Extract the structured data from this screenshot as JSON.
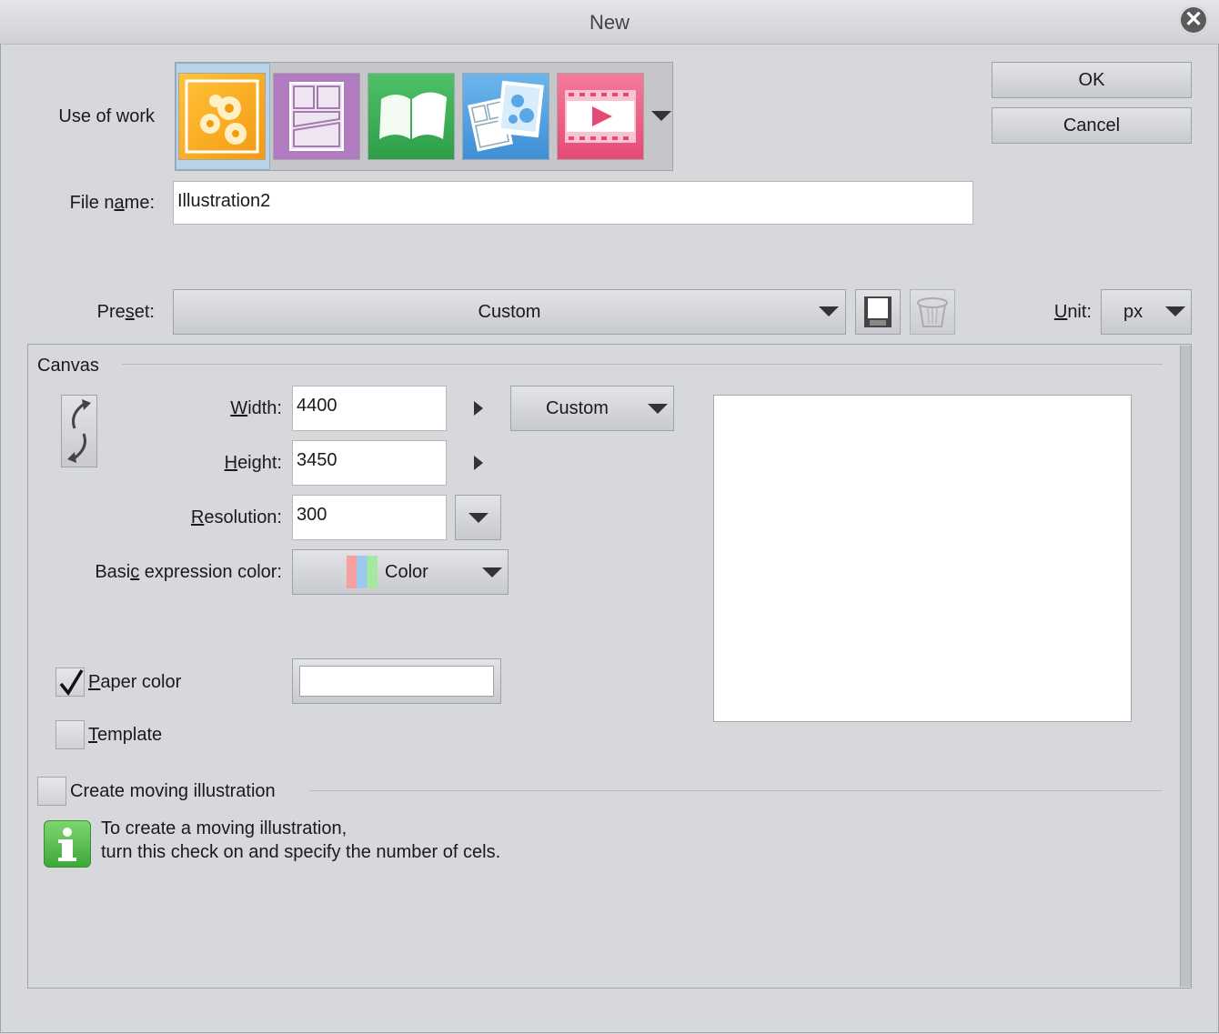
{
  "window": {
    "title": "New"
  },
  "buttons": {
    "ok": "OK",
    "cancel": "Cancel"
  },
  "use_of_work": {
    "label": "Use of work",
    "options": [
      "illustration",
      "comic",
      "book",
      "webtoon",
      "animation"
    ],
    "selected": "illustration"
  },
  "file_name": {
    "label_pre": "File n",
    "label_ul": "a",
    "label_post": "me:",
    "value": "Illustration2"
  },
  "preset": {
    "label_pre": "Pre",
    "label_ul": "s",
    "label_post": "et:",
    "value": "Custom"
  },
  "unit": {
    "label_ul": "U",
    "label_post": "nit:",
    "value": "px"
  },
  "canvas": {
    "section_label": "Canvas",
    "width": {
      "label_ul": "W",
      "label_post": "idth:",
      "value": "4400"
    },
    "height": {
      "label_ul": "H",
      "label_post": "eight:",
      "value": "3450"
    },
    "resolution": {
      "label_ul": "R",
      "label_post": "esolution:",
      "value": "300"
    },
    "size_preset": "Custom",
    "expression_color": {
      "label_pre": "Basi",
      "label_ul": "c",
      "label_post": " expression color:",
      "value": "Color"
    },
    "paper_color": {
      "label_ul": "P",
      "label_post": "aper color",
      "checked": true,
      "color": "#ffffff"
    },
    "template": {
      "label_ul": "T",
      "label_post": "emplate",
      "checked": false
    }
  },
  "moving": {
    "label": "Create moving illustration",
    "checked": false,
    "info_line1": "To create a moving illustration,",
    "info_line2": "turn this check on and specify the number of cels."
  },
  "colors": {
    "background": "#d6d8dc",
    "illustration_orange": "#f7a21b",
    "comic_purple": "#b07cbf",
    "book_green": "#3dae55",
    "webtoon_blue": "#4b9be0",
    "animation_pink": "#ec5a82",
    "info_green": "#4cb848"
  }
}
